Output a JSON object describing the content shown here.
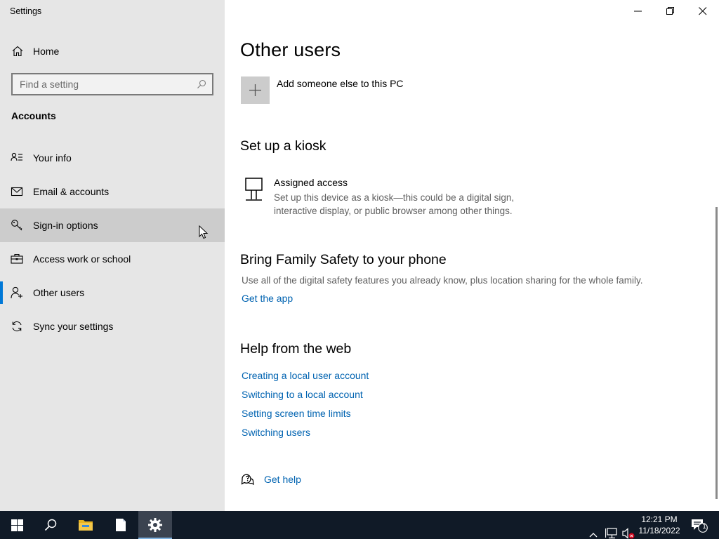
{
  "app": {
    "title": "Settings"
  },
  "sidebar": {
    "home_label": "Home",
    "search_placeholder": "Find a setting",
    "section_title": "Accounts",
    "items": [
      {
        "label": "Your info",
        "icon": "contact-card-icon"
      },
      {
        "label": "Email & accounts",
        "icon": "mail-icon"
      },
      {
        "label": "Sign-in options",
        "icon": "key-icon"
      },
      {
        "label": "Access work or school",
        "icon": "briefcase-icon"
      },
      {
        "label": "Other users",
        "icon": "person-add-icon"
      },
      {
        "label": "Sync your settings",
        "icon": "sync-icon"
      }
    ],
    "selected": "Other users",
    "hovered": "Sign-in options"
  },
  "main": {
    "title": "Other users",
    "add_label": "Add someone else to this PC",
    "kiosk": {
      "heading": "Set up a kiosk",
      "title": "Assigned access",
      "description": "Set up this device as a kiosk—this could be a digital sign, interactive display, or public browser among other things."
    },
    "family": {
      "heading": "Bring Family Safety to your phone",
      "text": "Use all of the digital safety features you already know, plus location sharing for the whole family.",
      "link": "Get the app"
    },
    "help": {
      "heading": "Help from the web",
      "links": [
        "Creating a local user account",
        "Switching to a local account",
        "Setting screen time limits",
        "Switching users"
      ]
    },
    "get_help": "Get help"
  },
  "taskbar": {
    "time": "12:21 PM",
    "date": "11/18/2022",
    "notification_count": "1",
    "colors": {
      "background": "#101a27",
      "accent": "#0078d7"
    }
  }
}
